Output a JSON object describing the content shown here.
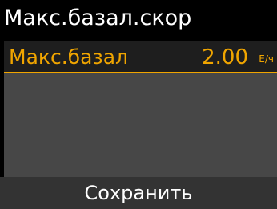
{
  "header": {
    "title": "Макс.базал.скор"
  },
  "setting": {
    "label": "Макс.базал",
    "value": "2.00",
    "unit": "Е/ч"
  },
  "softkey": {
    "label": "Сохранить"
  },
  "colors": {
    "background": "#000000",
    "accent": "#f0a500",
    "selected_row_bg": "#1e1e1e",
    "content_bg": "#474747",
    "softkey_bg": "#333333",
    "text": "#ffffff"
  }
}
